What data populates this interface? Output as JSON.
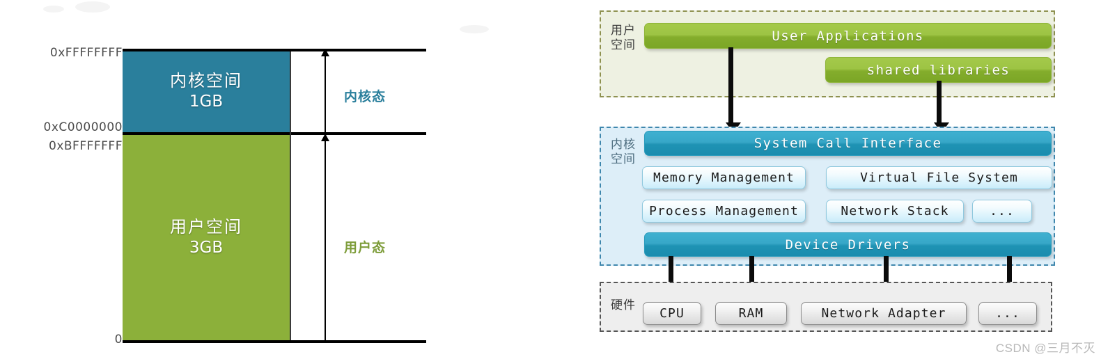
{
  "left_diagram": {
    "name": "linux-virtual-memory-layout",
    "addresses": [
      {
        "id": "top",
        "label": "0xFFFFFFFF"
      },
      {
        "id": "split1",
        "label": "0xC0000000"
      },
      {
        "id": "split2",
        "label": "0xBFFFFFFF"
      },
      {
        "id": "zero",
        "label": "0"
      }
    ],
    "blocks": [
      {
        "id": "kernel",
        "title": "内核空间",
        "size": "1GB",
        "color": "#2a7f9c"
      },
      {
        "id": "user",
        "title": "用户空间",
        "size": "3GB",
        "color": "#8cb03a"
      }
    ],
    "modes": [
      {
        "id": "kernel-mode",
        "label": "内核态",
        "color": "#2a7f9c"
      },
      {
        "id": "user-mode",
        "label": "用户态",
        "color": "#7d9c39"
      }
    ]
  },
  "right_diagram": {
    "name": "linux-kernel-architecture",
    "zones": [
      {
        "id": "user-space",
        "title": "用户\n空间",
        "background": "#eef1e2",
        "border_color": "#8e9150",
        "nodes": [
          {
            "id": "user-applications",
            "label": "User Applications",
            "style": "green"
          },
          {
            "id": "shared-libraries",
            "label": "shared libraries",
            "style": "green"
          }
        ]
      },
      {
        "id": "kernel-space",
        "title": "内核\n空间",
        "background": "#ddeef8",
        "border_color": "#3f87ad",
        "nodes": [
          {
            "id": "system-call-interface",
            "label": "System Call Interface",
            "style": "teal"
          },
          {
            "id": "memory-management",
            "label": "Memory Management",
            "style": "light"
          },
          {
            "id": "virtual-file-system",
            "label": "Virtual File System",
            "style": "light"
          },
          {
            "id": "process-management",
            "label": "Process Management",
            "style": "light"
          },
          {
            "id": "network-stack",
            "label": "Network Stack",
            "style": "light"
          },
          {
            "id": "kernel-more",
            "label": "...",
            "style": "light"
          },
          {
            "id": "device-drivers",
            "label": "Device Drivers",
            "style": "teal"
          }
        ]
      },
      {
        "id": "hardware",
        "title": "硬件",
        "background": "#eeeeee",
        "border_color": "#555555",
        "nodes": [
          {
            "id": "cpu",
            "label": "CPU",
            "style": "gray"
          },
          {
            "id": "ram",
            "label": "RAM",
            "style": "gray"
          },
          {
            "id": "network-adapter",
            "label": "Network Adapter",
            "style": "gray"
          },
          {
            "id": "hardware-more",
            "label": "...",
            "style": "gray"
          }
        ]
      }
    ]
  },
  "watermark": {
    "text": "CSDN @三月不灭"
  }
}
